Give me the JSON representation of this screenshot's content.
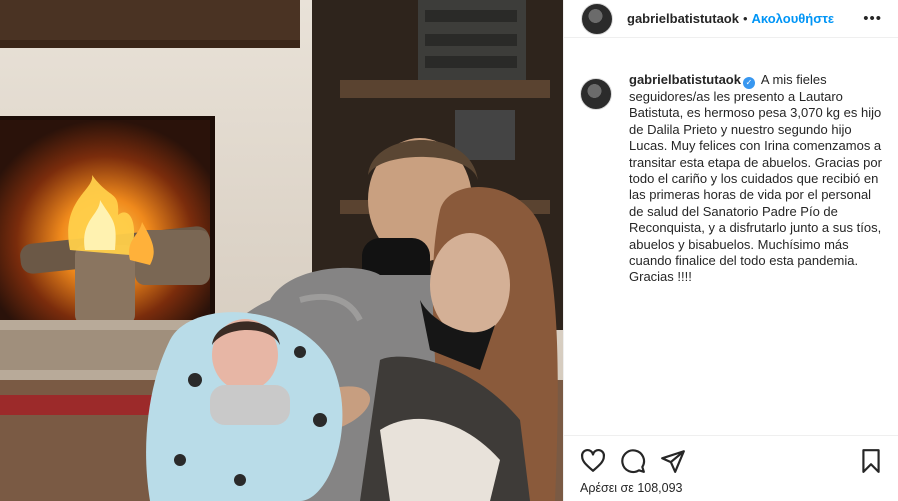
{
  "post": {
    "username": "gabrielbatistutaok",
    "follow_label": "Ακολουθήστε",
    "separator": "•",
    "more_icon": "more-horizontal-icon",
    "verified_icon": "verified-badge-icon",
    "caption": "A mis fieles seguidores/as les presento a Lautaro Batistuta, es hermoso pesa 3,070 kg es hijo de Dalila Prieto y nuestro segundo hijo Lucas. Muy felices con Irina comenzamos a transitar esta etapa de abuelos. Gracias por todo el cariño y los cuidados que recibió en las primeras horas de vida por el personal de salud del Sanatorio Padre Pío de Reconquista, y a disfrutarlo junto a sus tíos, abuelos y bisabuelos. Muchísimo más cuando finalice del todo esta pandemia. Gracias !!!!",
    "likes_text": "Αρέσει σε 108,093"
  },
  "actions": {
    "like_icon": "heart-icon",
    "comment_icon": "comment-bubble-icon",
    "share_icon": "paper-plane-icon",
    "save_icon": "bookmark-icon"
  },
  "colors": {
    "accent": "#0095f6",
    "verified": "#3897f0",
    "text": "#262626",
    "border": "#efefef"
  }
}
